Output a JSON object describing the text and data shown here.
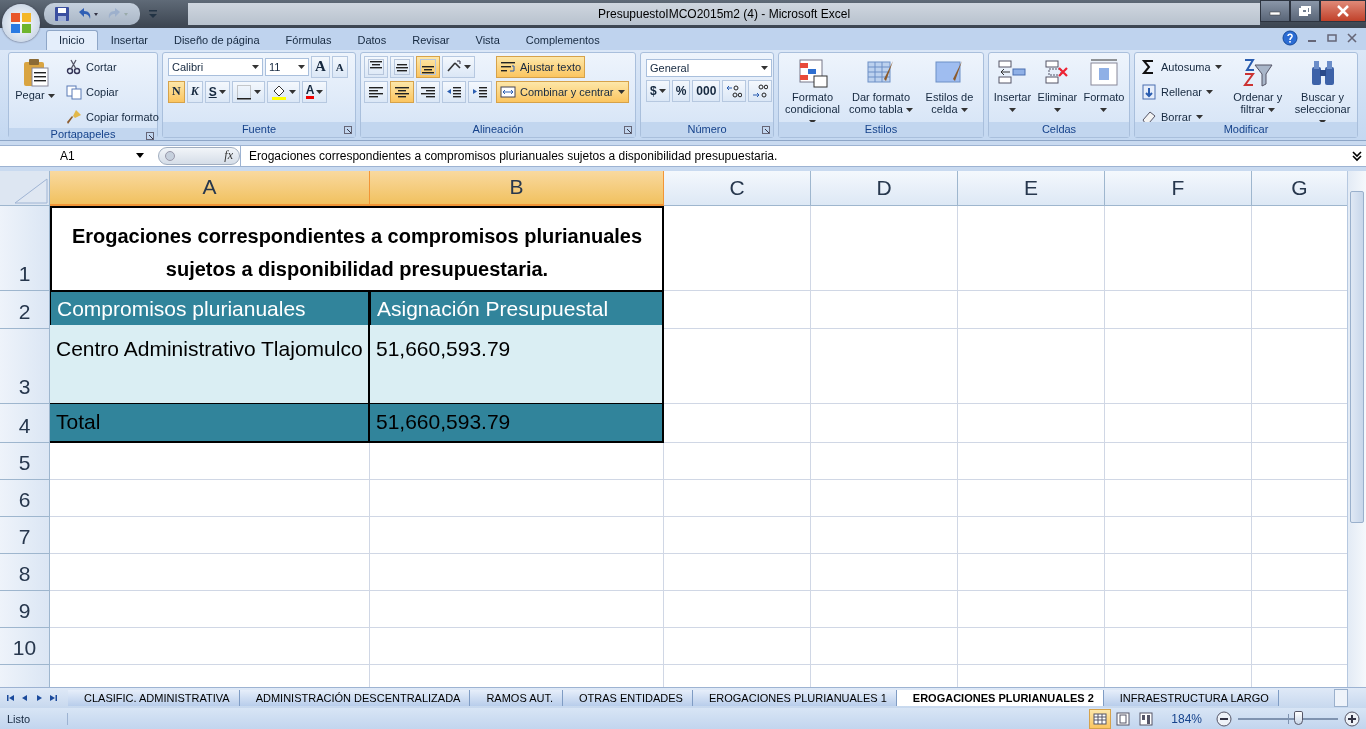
{
  "window": {
    "title": "PresupuestoIMCO2015m2 (4) - Microsoft Excel"
  },
  "ribbon_tabs": [
    {
      "label": "Inicio",
      "selected": true
    },
    {
      "label": "Insertar",
      "selected": false
    },
    {
      "label": "Diseño de página",
      "selected": false
    },
    {
      "label": "Fórmulas",
      "selected": false
    },
    {
      "label": "Datos",
      "selected": false
    },
    {
      "label": "Revisar",
      "selected": false
    },
    {
      "label": "Vista",
      "selected": false
    },
    {
      "label": "Complementos",
      "selected": false
    }
  ],
  "ribbon_groups": [
    {
      "label": "Portapapeles",
      "columns": [
        [
          [
            {
              "kind": "large",
              "label": "Pegar",
              "dropdown": true,
              "selected": false
            }
          ]
        ],
        [
          [
            {
              "kind": "small",
              "label": "Cortar",
              "dropdown": false,
              "selected": false
            }
          ],
          [
            {
              "kind": "small",
              "label": "Copiar",
              "dropdown": false,
              "selected": false
            }
          ],
          [
            {
              "kind": "small",
              "label": "Copiar formato",
              "dropdown": false,
              "selected": false
            }
          ]
        ]
      ]
    },
    {
      "label": "Fuente",
      "columns": [
        [
          [
            {
              "kind": "field",
              "value": "Calibri",
              "dropdown": true
            },
            {
              "kind": "field",
              "value": "11",
              "dropdown": true
            },
            {
              "kind": "button",
              "label": "A",
              "dropdown": false,
              "selected": false
            },
            {
              "kind": "button",
              "label": "A",
              "dropdown": false,
              "selected": false
            }
          ],
          [
            {
              "kind": "button",
              "label": "N",
              "dropdown": false,
              "selected": true
            },
            {
              "kind": "button",
              "label": "K",
              "dropdown": false,
              "selected": false
            },
            {
              "kind": "button",
              "label": "S",
              "dropdown": true,
              "selected": false
            },
            {
              "kind": "button",
              "dropdown": true,
              "selected": false
            },
            {
              "kind": "button",
              "dropdown": true,
              "selected": false
            },
            {
              "kind": "button",
              "label": "A",
              "dropdown": true,
              "selected": false
            }
          ]
        ]
      ]
    },
    {
      "label": "Alineación",
      "columns": [
        [
          [
            {
              "kind": "button",
              "dropdown": false,
              "selected": false
            },
            {
              "kind": "button",
              "dropdown": false,
              "selected": false
            },
            {
              "kind": "button",
              "dropdown": false,
              "selected": true
            },
            {
              "kind": "button",
              "dropdown": true,
              "selected": false
            }
          ],
          [
            {
              "kind": "button",
              "dropdown": false,
              "selected": false
            },
            {
              "kind": "button",
              "dropdown": false,
              "selected": true
            },
            {
              "kind": "button",
              "dropdown": false,
              "selected": false
            },
            {
              "kind": "button",
              "dropdown": false,
              "selected": false
            },
            {
              "kind": "button",
              "dropdown": false,
              "selected": false
            }
          ]
        ],
        [
          [
            {
              "kind": "small",
              "label": "Ajustar texto",
              "dropdown": false,
              "selected": true
            }
          ],
          [
            {
              "kind": "small",
              "label": "Combinar y centrar",
              "dropdown": true,
              "selected": true
            }
          ]
        ]
      ]
    },
    {
      "label": "Número",
      "columns": [
        [
          [
            {
              "kind": "field",
              "value": "General",
              "dropdown": true
            }
          ],
          [
            {
              "kind": "button",
              "label": "$",
              "dropdown": true,
              "selected": false
            },
            {
              "kind": "button",
              "label": "%",
              "dropdown": false,
              "selected": false
            },
            {
              "kind": "button",
              "label": "000",
              "dropdown": false,
              "selected": false
            },
            {
              "kind": "button",
              "dropdown": false,
              "selected": false
            },
            {
              "kind": "button",
              "dropdown": false,
              "selected": false
            }
          ]
        ]
      ]
    },
    {
      "label": "Estilos",
      "columns": [
        [
          [
            {
              "kind": "large",
              "label": "Formato condicional",
              "dropdown": true,
              "selected": false
            }
          ]
        ],
        [
          [
            {
              "kind": "large",
              "label": "Dar formato como tabla",
              "dropdown": true,
              "selected": false
            }
          ]
        ],
        [
          [
            {
              "kind": "large",
              "label": "Estilos de celda",
              "dropdown": true,
              "selected": false
            }
          ]
        ]
      ]
    },
    {
      "label": "Celdas",
      "columns": [
        [
          [
            {
              "kind": "large",
              "label": "Insertar",
              "dropdown": true,
              "selected": false
            }
          ]
        ],
        [
          [
            {
              "kind": "large",
              "label": "Eliminar",
              "dropdown": true,
              "selected": false
            }
          ]
        ],
        [
          [
            {
              "kind": "large",
              "label": "Formato",
              "dropdown": true,
              "selected": false
            }
          ]
        ]
      ]
    },
    {
      "label": "Modificar",
      "columns": [
        [
          [
            {
              "kind": "small",
              "label": "Autosuma",
              "dropdown": true,
              "selected": false
            }
          ],
          [
            {
              "kind": "small",
              "label": "Rellenar",
              "dropdown": true,
              "selected": false
            }
          ],
          [
            {
              "kind": "small",
              "label": "Borrar",
              "dropdown": true,
              "selected": false
            }
          ]
        ],
        [
          [
            {
              "kind": "large",
              "label": "Ordenar y filtrar",
              "dropdown": true,
              "selected": false
            }
          ]
        ],
        [
          [
            {
              "kind": "large",
              "label": "Buscar y seleccionar",
              "dropdown": true,
              "selected": false
            }
          ]
        ]
      ]
    }
  ],
  "formula_bar": {
    "name_box": "A1",
    "function_label": "fx",
    "formula": "Erogaciones correspondientes a compromisos plurianuales sujetos a disponibilidad presupuestaria."
  },
  "columns": [
    {
      "label": "A",
      "selected": true
    },
    {
      "label": "B",
      "selected": true
    },
    {
      "label": "C",
      "selected": false
    },
    {
      "label": "D",
      "selected": false
    },
    {
      "label": "E",
      "selected": false
    },
    {
      "label": "F",
      "selected": false
    },
    {
      "label": "G",
      "selected": false
    }
  ],
  "rows": [
    {
      "header": "1",
      "cells": [
        {
          "text": "Erogaciones correspondientes a compromisos plurianuales sujetos a disponibilidad presupuestaria.",
          "kind": "title"
        }
      ]
    },
    {
      "header": "2",
      "cells": [
        {
          "text": "Compromisos plurianuales",
          "kind": "header"
        },
        {
          "text": "Asignación Presupuestal",
          "kind": "header"
        }
      ]
    },
    {
      "header": "3",
      "cells": [
        {
          "text": "Centro Administrativo Tlajomulco",
          "kind": "body"
        },
        {
          "text": "51,660,593.79",
          "kind": "body"
        }
      ]
    },
    {
      "header": "4",
      "cells": [
        {
          "text": "Total",
          "kind": "total"
        },
        {
          "text": "51,660,593.79",
          "kind": "total"
        }
      ]
    },
    {
      "header": "5",
      "cells": []
    },
    {
      "header": "6",
      "cells": []
    },
    {
      "header": "7",
      "cells": []
    },
    {
      "header": "8",
      "cells": []
    },
    {
      "header": "9",
      "cells": []
    },
    {
      "header": "10",
      "cells": []
    }
  ],
  "sheet_tabs": [
    {
      "label": "CLASIFIC. ADMINISTRATIVA",
      "selected": false
    },
    {
      "label": "ADMINISTRACIÓN DESCENTRALIZADA",
      "selected": false
    },
    {
      "label": "RAMOS AUT.",
      "selected": false
    },
    {
      "label": "OTRAS ENTIDADES",
      "selected": false
    },
    {
      "label": "EROGACIONES PLURIANUALES 1",
      "selected": false
    },
    {
      "label": "EROGACIONES PLURIANUALES 2",
      "selected": true
    },
    {
      "label": "INFRAESTRUCTURA LARGO",
      "selected": false
    }
  ],
  "status_bar": {
    "status": "Listo",
    "views": [
      {
        "selected": true
      },
      {
        "selected": false
      },
      {
        "selected": false
      }
    ],
    "zoom": "184%",
    "zoom_slider": {
      "level": 0.6
    }
  }
}
